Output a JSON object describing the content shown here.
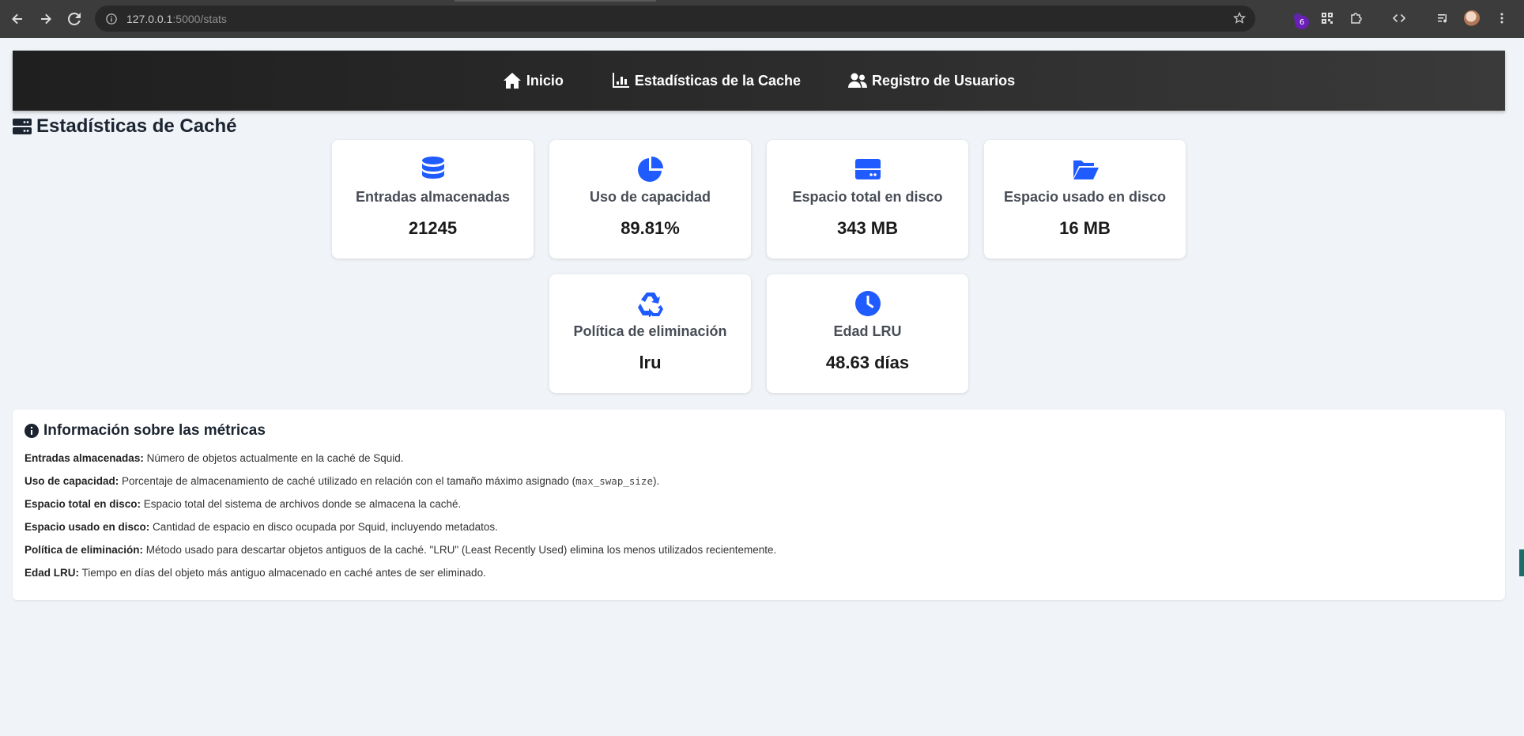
{
  "browser": {
    "url_host": "127.0.0.1",
    "url_rest": ":5000/stats",
    "extension_badge": "6",
    "icons": [
      "back-icon",
      "forward-icon",
      "reload-icon",
      "info-icon",
      "star-icon",
      "qr-icon",
      "puzzle-icon",
      "code-icon",
      "media-icon",
      "menu-icon"
    ]
  },
  "nav": {
    "items": [
      {
        "label": "Inicio",
        "icon": "home-icon"
      },
      {
        "label": "Estadísticas de la Cache",
        "icon": "chart-icon"
      },
      {
        "label": "Registro de Usuarios",
        "icon": "users-icon"
      }
    ]
  },
  "page": {
    "title": "Estadísticas de Caché",
    "title_icon": "server-icon"
  },
  "cards": [
    {
      "label": "Entradas almacenadas",
      "value": "21245",
      "icon": "database-icon"
    },
    {
      "label": "Uso de capacidad",
      "value": "89.81%",
      "icon": "pie-chart-icon"
    },
    {
      "label": "Espacio total en disco",
      "value": "343 MB",
      "icon": "hard-drive-icon"
    },
    {
      "label": "Espacio usado en disco",
      "value": "16 MB",
      "icon": "folder-open-icon"
    },
    {
      "label": "Política de eliminación",
      "value": "lru",
      "icon": "recycle-icon"
    },
    {
      "label": "Edad LRU",
      "value": "48.63 días",
      "icon": "clock-icon"
    }
  ],
  "info": {
    "title": "Información sobre las métricas",
    "items": [
      {
        "term": "Entradas almacenadas:",
        "desc": " Número de objetos actualmente en la caché de Squid."
      },
      {
        "term": "Uso de capacidad:",
        "desc": " Porcentaje de almacenamiento de caché utilizado en relación con el tamaño máximo asignado (",
        "code": "max_swap_size",
        "after": ")."
      },
      {
        "term": "Espacio total en disco:",
        "desc": " Espacio total del sistema de archivos donde se almacena la caché."
      },
      {
        "term": "Espacio usado en disco:",
        "desc": " Cantidad de espacio en disco ocupada por Squid, incluyendo metadatos."
      },
      {
        "term": "Política de eliminación:",
        "desc": " Método usado para descartar objetos antiguos de la caché. \"LRU\" (Least Recently Used) elimina los menos utilizados recientemente."
      },
      {
        "term": "Edad LRU:",
        "desc": " Tiempo en días del objeto más antiguo almacenado en caché antes de ser eliminado."
      }
    ]
  },
  "colors": {
    "accent": "#1f5bff",
    "nav_bg": "#262626",
    "page_bg": "#f0f3f7"
  }
}
